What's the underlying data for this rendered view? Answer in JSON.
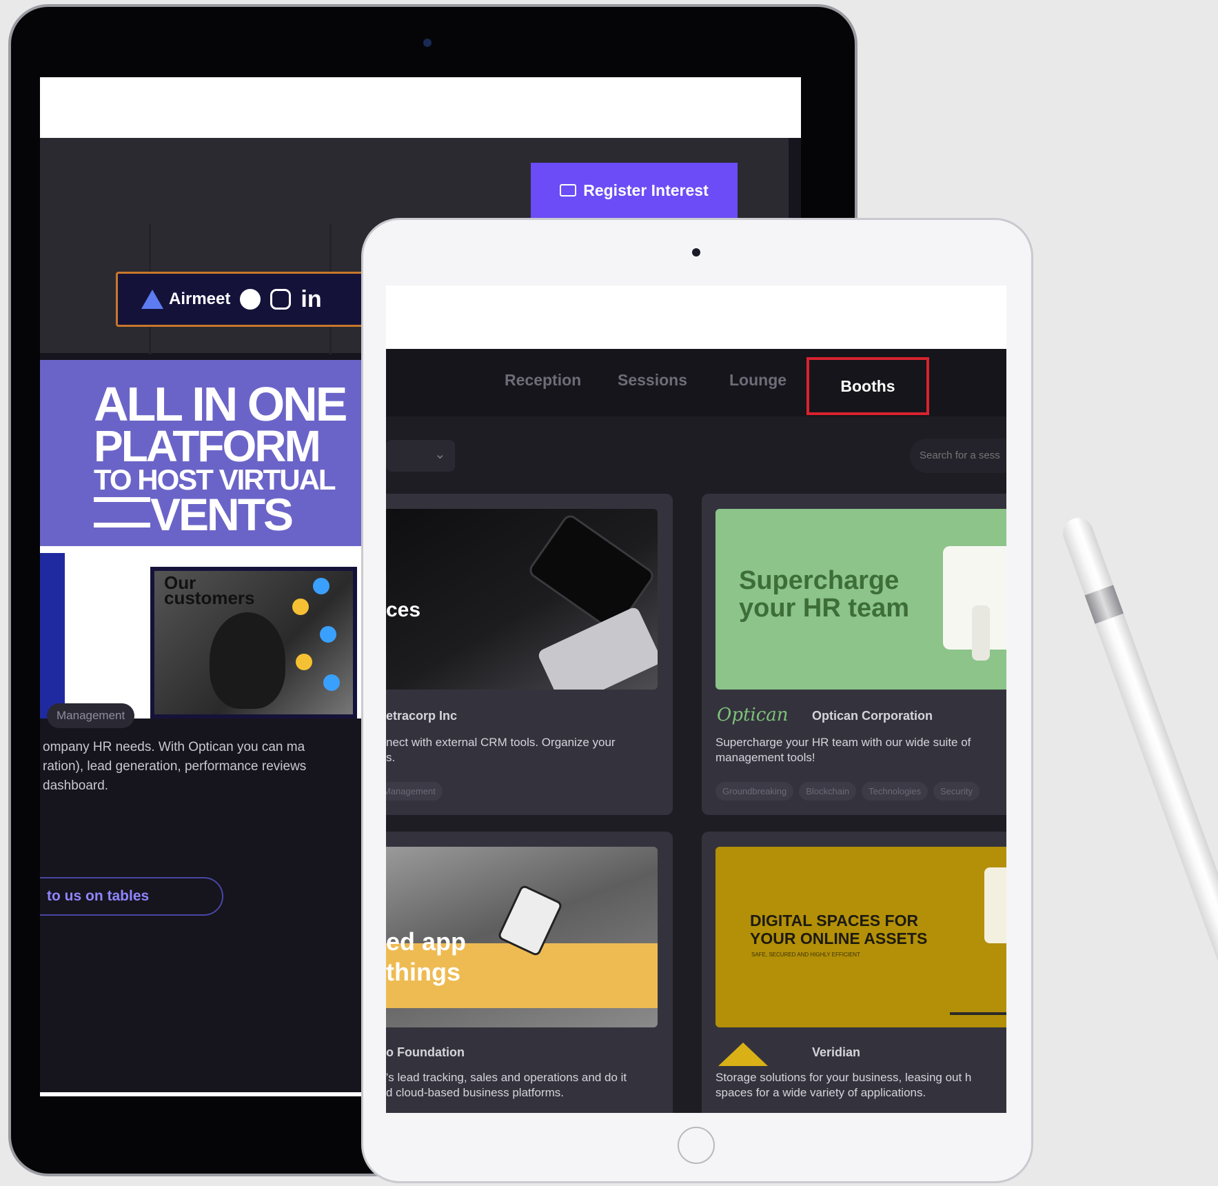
{
  "back_tablet": {
    "register_label": "Register Interest",
    "brand": {
      "name": "Airmeet",
      "social": [
        "facebook-icon",
        "instagram-icon",
        "linkedin-icon"
      ],
      "linkedin_partial": "in"
    },
    "promo": {
      "line1": "ALL IN ONE",
      "line2": "PLATFORM",
      "line3": "TO HOST VIRTUAL",
      "line4": "VENTS",
      "customers_label": "Our customers"
    },
    "tag": "Management",
    "description": "ompany HR needs. With Optican you can ma\nration), lead generation, performance reviews\ndashboard.",
    "cta_label": "to us on tables"
  },
  "front_tablet": {
    "nav": {
      "reception": "Reception",
      "sessions": "Sessions",
      "lounge": "Lounge",
      "booths": "Booths"
    },
    "search_placeholder": "Search for a sess",
    "booths": [
      {
        "image_text": "ces",
        "name": "etracorp Inc",
        "description": "nect with external CRM tools. Organize your\ns.",
        "tags": [
          "Management"
        ]
      },
      {
        "image_text": "Supercharge\nyour HR team",
        "logo": "Optican",
        "name": "Optican Corporation",
        "description": "Supercharge your HR team with our wide suite of\nmanagement tools!",
        "tags": [
          "Groundbreaking",
          "Blockchain",
          "Technologies",
          "Security"
        ]
      },
      {
        "image_text": "ed app\nthings",
        "name": "o Foundation",
        "description": "'s lead tracking, sales and operations and do it\nd cloud-based business platforms."
      },
      {
        "image_text": "DIGITAL SPACES FOR\nYOUR ONLINE ASSETS",
        "image_subtext": "SAFE, SECURED AND HIGHLY EFFICIENT",
        "name": "Veridian",
        "description": "Storage solutions for your business, leasing out h\nspaces for a wide variety of applications."
      }
    ]
  },
  "colors": {
    "accent": "#6c4cf6",
    "highlight": "#d9222f",
    "booth_green": "#8cc48a",
    "booth_gold": "#b39007"
  }
}
